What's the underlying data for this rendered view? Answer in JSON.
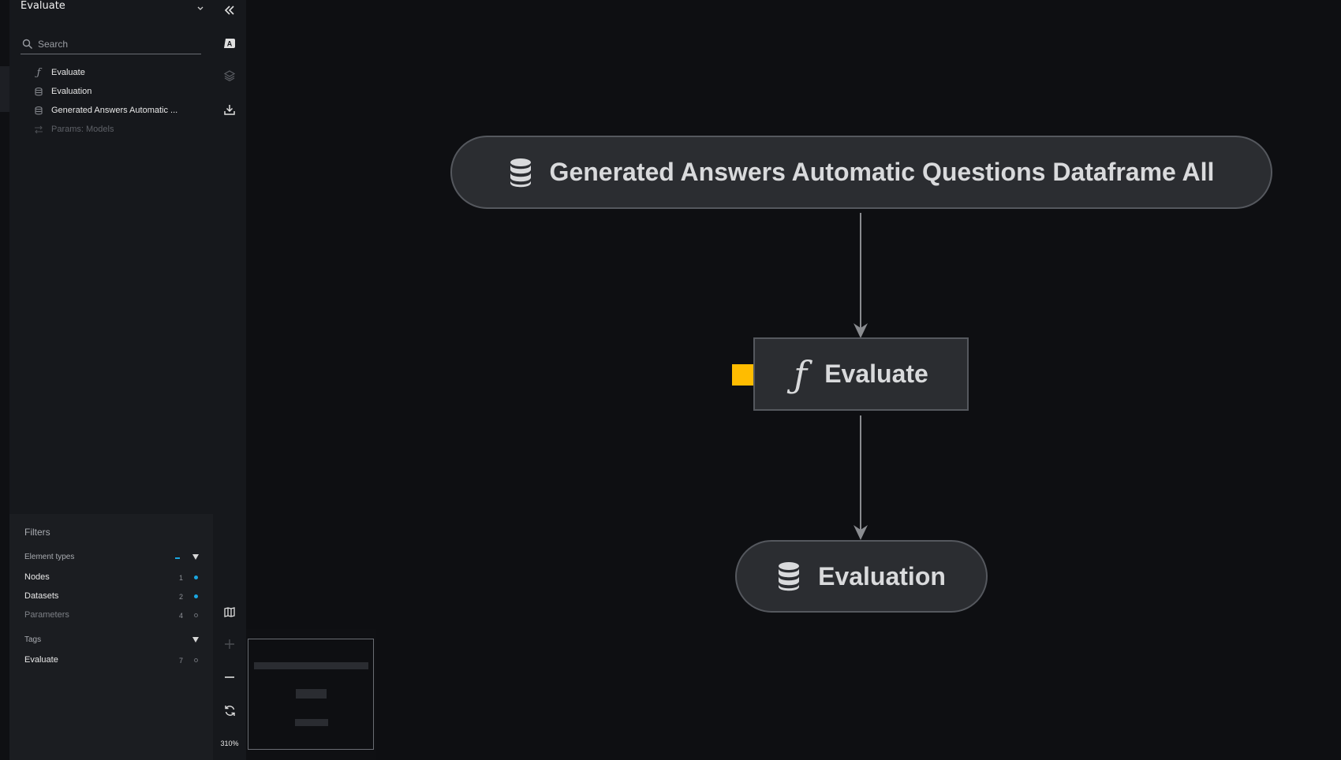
{
  "sidebar": {
    "pipeline_name": "Evaluate",
    "search_placeholder": "Search",
    "tree": [
      {
        "label": "Evaluate",
        "icon": "function-icon"
      },
      {
        "label": "Evaluation",
        "icon": "database-icon"
      },
      {
        "label": "Generated Answers Automatic ...",
        "icon": "database-icon"
      },
      {
        "label": "Params: Models",
        "icon": "parameters-icon"
      }
    ]
  },
  "filters": {
    "title": "Filters",
    "element_types_label": "Element types",
    "element_types": [
      {
        "label": "Nodes",
        "count": "1",
        "enabled": true
      },
      {
        "label": "Datasets",
        "count": "2",
        "enabled": true
      },
      {
        "label": "Parameters",
        "count": "4",
        "enabled": false
      }
    ],
    "tags_label": "Tags",
    "tags": [
      {
        "label": "Evaluate",
        "count": "7",
        "enabled": false
      }
    ]
  },
  "toolbar": {
    "zoom_level": "310%"
  },
  "graph": {
    "nodes": [
      {
        "label": "Generated Answers Automatic Questions Dataframe All",
        "type": "dataset"
      },
      {
        "label": "Evaluate",
        "type": "task"
      },
      {
        "label": "Evaluation",
        "type": "dataset"
      }
    ],
    "parameter_indicator_color": "#ffbc00"
  },
  "colors": {
    "accent": "#1aa6e0",
    "background": "#0e0f12",
    "node_fill": "#2b2d31"
  }
}
